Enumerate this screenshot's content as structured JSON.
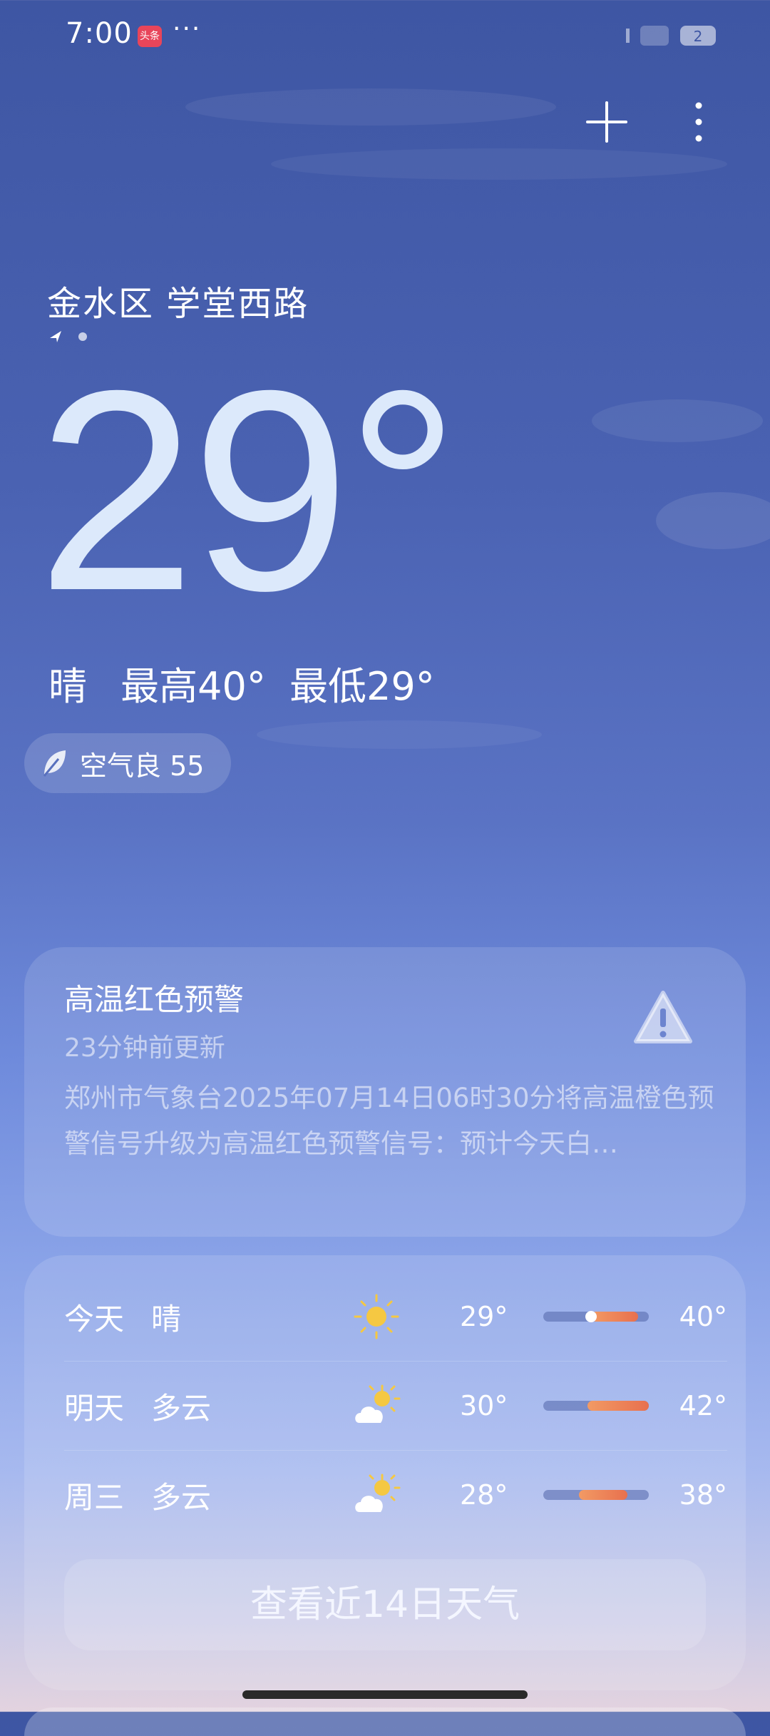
{
  "status_bar": {
    "time": "7:00",
    "app_badge": "头条",
    "more": "···"
  },
  "header": {
    "add_icon": "plus-icon",
    "more_icon": "vertical-more-icon"
  },
  "location": {
    "name": "金水区 学堂西路"
  },
  "current": {
    "temperature": "29°",
    "condition": "晴",
    "high": "最高40°",
    "low": "最低29°",
    "aqi_label": "空气良 55"
  },
  "alert": {
    "title": "高温红色预警",
    "updated": "23分钟前更新",
    "text": "郑州市气象台2025年07月14日06时30分将高温橙色预警信号升级为高温红色预警信号：预计今天白…",
    "icon": "warning-icon"
  },
  "forecast": {
    "days": [
      {
        "day": "今天",
        "desc": "晴",
        "icon": "sun-icon",
        "low": "29°",
        "high": "40°",
        "range_start": 0.45,
        "range_end": 0.9,
        "current": 0.45
      },
      {
        "day": "明天",
        "desc": "多云",
        "icon": "partly-cloudy-icon",
        "low": "30°",
        "high": "42°",
        "range_start": 0.42,
        "range_end": 1.0
      },
      {
        "day": "周三",
        "desc": "多云",
        "icon": "partly-cloudy-icon",
        "low": "28°",
        "high": "38°",
        "range_start": 0.34,
        "range_end": 0.8
      }
    ],
    "more_button": "查看近14日天气"
  },
  "colors": {
    "temp_bar_fill": "#ec7a52",
    "sun": "#f5c842"
  }
}
